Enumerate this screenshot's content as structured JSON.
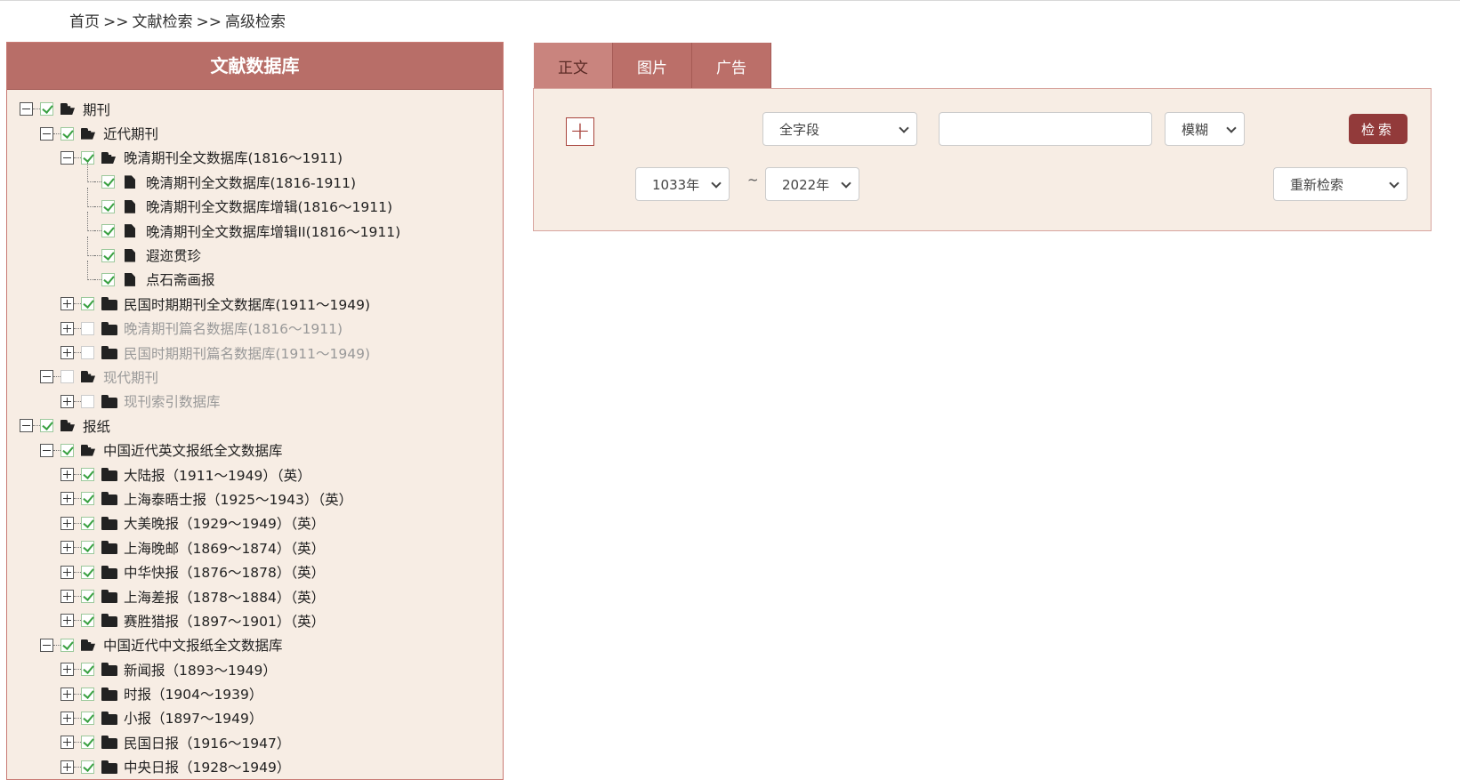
{
  "breadcrumb": [
    "首页",
    ">>",
    "文献检索",
    ">>",
    "高级检索"
  ],
  "panel": {
    "title": "文献数据库",
    "tree": [
      {
        "level": 0,
        "toggle": "minus",
        "checked": true,
        "icon": "folder-open",
        "label": "期刊",
        "dim": false
      },
      {
        "level": 1,
        "toggle": "minus",
        "checked": true,
        "icon": "folder-open",
        "label": "近代期刊",
        "dim": false
      },
      {
        "level": 2,
        "toggle": "minus",
        "checked": true,
        "icon": "folder-open",
        "label": "晚清期刊全文数据库(1816～1911)",
        "dim": false
      },
      {
        "level": 3,
        "toggle": "none",
        "checked": true,
        "icon": "file",
        "label": "晚清期刊全文数据库(1816-1911)",
        "dim": false
      },
      {
        "level": 3,
        "toggle": "none",
        "checked": true,
        "icon": "file",
        "label": "晚清期刊全文数据库增辑(1816～1911)",
        "dim": false
      },
      {
        "level": 3,
        "toggle": "none",
        "checked": true,
        "icon": "file",
        "label": "晚清期刊全文数据库增辑II(1816～1911)",
        "dim": false
      },
      {
        "level": 3,
        "toggle": "none",
        "checked": true,
        "icon": "file",
        "label": "遐迩贯珍",
        "dim": false
      },
      {
        "level": 3,
        "toggle": "none",
        "checked": true,
        "icon": "file",
        "label": "点石斋画报",
        "dim": false
      },
      {
        "level": 2,
        "toggle": "plus",
        "checked": true,
        "icon": "folder",
        "label": "民国时期期刊全文数据库(1911～1949)",
        "dim": false
      },
      {
        "level": 2,
        "toggle": "plus",
        "checked": false,
        "icon": "folder",
        "label": "晚清期刊篇名数据库(1816～1911)",
        "dim": true
      },
      {
        "level": 2,
        "toggle": "plus",
        "checked": false,
        "icon": "folder",
        "label": "民国时期期刊篇名数据库(1911～1949)",
        "dim": true
      },
      {
        "level": 1,
        "toggle": "minus",
        "checked": false,
        "icon": "folder-open",
        "label": "现代期刊",
        "dim": true
      },
      {
        "level": 2,
        "toggle": "plus",
        "checked": false,
        "icon": "folder",
        "label": "现刊索引数据库",
        "dim": true
      },
      {
        "level": 0,
        "toggle": "minus",
        "checked": true,
        "icon": "folder-open",
        "label": "报纸",
        "dim": false
      },
      {
        "level": 1,
        "toggle": "minus",
        "checked": true,
        "icon": "folder-open",
        "label": "中国近代英文报纸全文数据库",
        "dim": false
      },
      {
        "level": 2,
        "toggle": "plus",
        "checked": true,
        "icon": "folder",
        "label": "大陆报（1911～1949）（英）",
        "dim": false
      },
      {
        "level": 2,
        "toggle": "plus",
        "checked": true,
        "icon": "folder",
        "label": "上海泰晤士报（1925～1943）（英）",
        "dim": false
      },
      {
        "level": 2,
        "toggle": "plus",
        "checked": true,
        "icon": "folder",
        "label": "大美晚报（1929～1949）（英）",
        "dim": false
      },
      {
        "level": 2,
        "toggle": "plus",
        "checked": true,
        "icon": "folder",
        "label": "上海晚邮（1869～1874）（英）",
        "dim": false
      },
      {
        "level": 2,
        "toggle": "plus",
        "checked": true,
        "icon": "folder",
        "label": "中华快报（1876～1878）（英）",
        "dim": false
      },
      {
        "level": 2,
        "toggle": "plus",
        "checked": true,
        "icon": "folder",
        "label": "上海差报（1878～1884）（英）",
        "dim": false
      },
      {
        "level": 2,
        "toggle": "plus",
        "checked": true,
        "icon": "folder",
        "label": "赛胜猎报（1897～1901）（英）",
        "dim": false
      },
      {
        "level": 1,
        "toggle": "minus",
        "checked": true,
        "icon": "folder-open",
        "label": "中国近代中文报纸全文数据库",
        "dim": false
      },
      {
        "level": 2,
        "toggle": "plus",
        "checked": true,
        "icon": "folder",
        "label": "新闻报（1893～1949）",
        "dim": false
      },
      {
        "level": 2,
        "toggle": "plus",
        "checked": true,
        "icon": "folder",
        "label": "时报（1904～1939）",
        "dim": false
      },
      {
        "level": 2,
        "toggle": "plus",
        "checked": true,
        "icon": "folder",
        "label": "小报（1897～1949）",
        "dim": false
      },
      {
        "level": 2,
        "toggle": "plus",
        "checked": true,
        "icon": "folder",
        "label": "民国日报（1916～1947）",
        "dim": false
      },
      {
        "level": 2,
        "toggle": "plus",
        "checked": true,
        "icon": "folder",
        "label": "中央日报（1928～1949）",
        "dim": false
      }
    ]
  },
  "tabs": [
    {
      "label": "正文",
      "active": true
    },
    {
      "label": "图片",
      "active": false
    },
    {
      "label": "广告",
      "active": false
    }
  ],
  "search": {
    "add_symbol": "+",
    "field_select": "全字段",
    "query_value": "",
    "match_select": "模糊",
    "search_button": "检索",
    "year_from": "1033年",
    "year_sep": "~",
    "year_to": "2022年",
    "research_select": "重新检索"
  },
  "colors": {
    "header": "#b86e68",
    "panel_bg": "#f7ede4",
    "search_button": "#923a3a",
    "check": "#3aa142"
  }
}
